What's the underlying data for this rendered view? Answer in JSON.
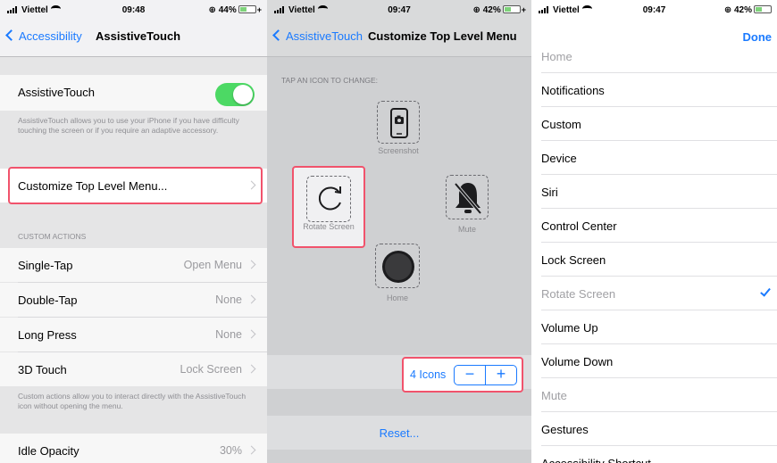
{
  "panel1": {
    "status": {
      "carrier": "Viettel",
      "time": "09:48",
      "battery": "44%",
      "battery_level": 0.44
    },
    "back_label": "Accessibility",
    "title": "AssistiveTouch",
    "toggle_label": "AssistiveTouch",
    "toggle_on": true,
    "description": "AssistiveTouch allows you to use your iPhone if you have difficulty touching the screen or if you require an adaptive accessory.",
    "customize_label": "Customize Top Level Menu...",
    "section_header": "CUSTOM ACTIONS",
    "actions": [
      {
        "label": "Single-Tap",
        "value": "Open Menu"
      },
      {
        "label": "Double-Tap",
        "value": "None"
      },
      {
        "label": "Long Press",
        "value": "None"
      },
      {
        "label": "3D Touch",
        "value": "Lock Screen"
      }
    ],
    "actions_footer": "Custom actions allow you to interact directly with the AssistiveTouch icon without opening the menu.",
    "idle": {
      "label": "Idle Opacity",
      "value": "30%"
    }
  },
  "panel2": {
    "status": {
      "carrier": "Viettel",
      "time": "09:47",
      "battery": "42%",
      "battery_level": 0.42
    },
    "back_label": "AssistiveTouch",
    "title": "Customize Top Level Menu",
    "hint": "TAP AN ICON TO CHANGE:",
    "icons": {
      "screenshot": "Screenshot",
      "rotate": "Rotate Screen",
      "mute": "Mute",
      "home": "Home"
    },
    "count_label": "4 Icons",
    "minus": "−",
    "plus": "+",
    "reset": "Reset..."
  },
  "panel3": {
    "status": {
      "carrier": "Viettel",
      "time": "09:47",
      "battery": "42%",
      "battery_level": 0.42
    },
    "done": "Done",
    "items": [
      {
        "label": "Home",
        "dim": true
      },
      {
        "label": "Notifications"
      },
      {
        "label": "Custom"
      },
      {
        "label": "Device"
      },
      {
        "label": "Siri"
      },
      {
        "label": "Control Center"
      },
      {
        "label": "Lock Screen"
      },
      {
        "label": "Rotate Screen",
        "dim": true,
        "checked": true
      },
      {
        "label": "Volume Up"
      },
      {
        "label": "Volume Down"
      },
      {
        "label": "Mute",
        "dim": true
      },
      {
        "label": "Gestures"
      },
      {
        "label": "Accessibility Shortcut"
      }
    ]
  },
  "colors": {
    "accent": "#1a7aff",
    "toggle_on": "#4cd964",
    "highlight": "#f1536c"
  }
}
